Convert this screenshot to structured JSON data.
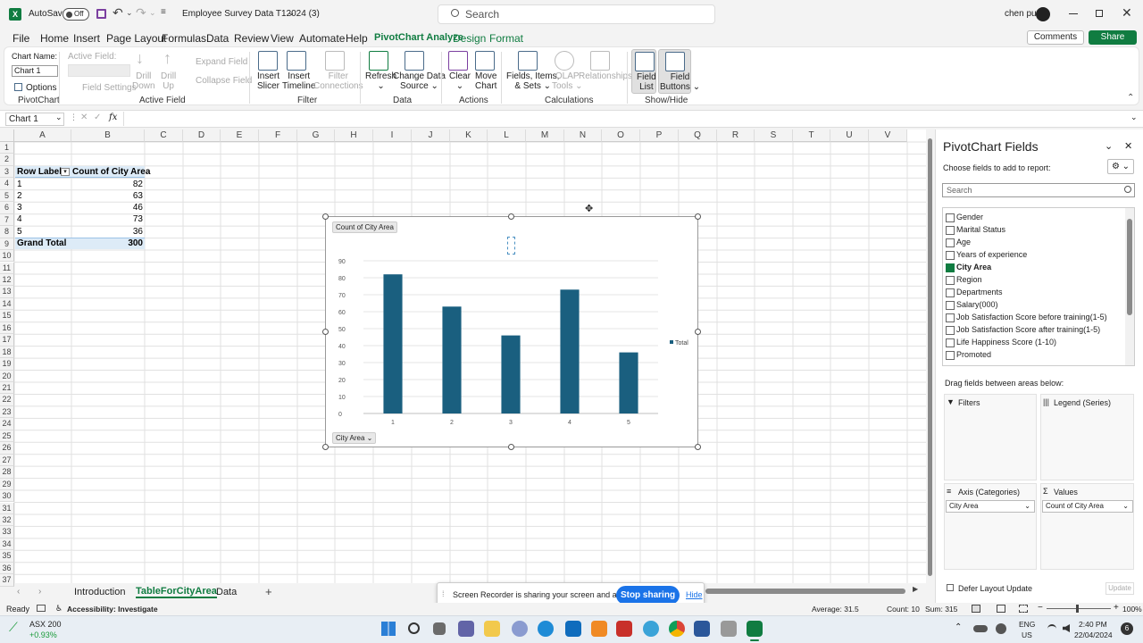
{
  "titlebar": {
    "autosave": "AutoSave",
    "autosave_state": "Off",
    "doc_title": "Employee Survey Data T12024 (3)",
    "search_placeholder": "Search",
    "user": "chen pu"
  },
  "menu": {
    "tabs": [
      "File",
      "Home",
      "Insert",
      "Page Layout",
      "Formulas",
      "Data",
      "Review",
      "View",
      "Automate",
      "Help",
      "PivotChart Analyze",
      "Design",
      "Format"
    ],
    "active": "PivotChart Analyze",
    "comments": "Comments",
    "share": "Share"
  },
  "ribbon": {
    "chart_name_label": "Chart Name:",
    "chart_name_value": "Chart 1",
    "options": "Options",
    "pivotchart_group": "PivotChart",
    "active_field_label": "Active Field:",
    "field_settings": "Field Settings",
    "drill_down": [
      "Drill",
      "Down"
    ],
    "drill_up": [
      "Drill",
      "Up"
    ],
    "expand_field": "Expand Field",
    "collapse_field": "Collapse Field",
    "active_field_group": "Active Field",
    "insert_slicer": [
      "Insert",
      "Slicer"
    ],
    "insert_timeline": [
      "Insert",
      "Timeline"
    ],
    "filter_connections": [
      "Filter",
      "Connections"
    ],
    "filter_group": "Filter",
    "refresh": [
      "Refresh",
      "⌄"
    ],
    "change_data_source": [
      "Change Data",
      "Source ⌄"
    ],
    "data_group": "Data",
    "clear": [
      "Clear",
      "⌄"
    ],
    "move_chart": [
      "Move",
      "Chart"
    ],
    "actions_group": "Actions",
    "fields_items_sets": [
      "Fields, Items,",
      "& Sets ⌄"
    ],
    "olap_tools": [
      "OLAP",
      "Tools ⌄"
    ],
    "relationships": "Relationships",
    "calculations_group": "Calculations",
    "field_list": [
      "Field",
      "List"
    ],
    "field_buttons": [
      "Field",
      "Buttons ⌄"
    ],
    "showhide_group": "Show/Hide"
  },
  "formula_bar": {
    "name_box": "Chart 1",
    "fx": "fx"
  },
  "grid": {
    "columns": [
      "A",
      "B",
      "C",
      "D",
      "E",
      "F",
      "G",
      "H",
      "I",
      "J",
      "K",
      "L",
      "M",
      "N",
      "O",
      "P",
      "Q",
      "R",
      "S",
      "T",
      "U",
      "V"
    ],
    "rows": [
      "1",
      "2",
      "3",
      "4",
      "5",
      "6",
      "7",
      "8",
      "9",
      "10",
      "11",
      "12",
      "13",
      "14",
      "15",
      "16",
      "17",
      "18",
      "19",
      "20",
      "21",
      "22",
      "23",
      "24",
      "25",
      "26",
      "27",
      "28",
      "29",
      "30",
      "31",
      "32",
      "33",
      "34",
      "35",
      "36",
      "37"
    ],
    "pivot_header": [
      "Row Labels",
      "Count of City Area"
    ],
    "pivot_rows": [
      [
        "1",
        "82"
      ],
      [
        "2",
        "63"
      ],
      [
        "3",
        "46"
      ],
      [
        "4",
        "73"
      ],
      [
        "5",
        "36"
      ]
    ],
    "grand_total": [
      "Grand Total",
      "300"
    ]
  },
  "chart_data": {
    "type": "bar",
    "categories": [
      "1",
      "2",
      "3",
      "4",
      "5"
    ],
    "series": [
      {
        "name": "Total",
        "values": [
          82,
          63,
          46,
          73,
          36
        ],
        "color": "#1a5f7f"
      }
    ],
    "title": "",
    "xlabel": "",
    "ylabel": "",
    "ylim": [
      0,
      90
    ],
    "yticks": [
      "0",
      "10",
      "20",
      "30",
      "40",
      "50",
      "60",
      "70",
      "80",
      "90"
    ],
    "grid": true,
    "legend": "right",
    "value_button": "Count of City Area",
    "axis_button": "City Area ⌄"
  },
  "pane": {
    "title": "PivotChart Fields",
    "subtitle": "Choose fields to add to report:",
    "search_placeholder": "Search",
    "fields": [
      {
        "label": "Gender",
        "checked": false
      },
      {
        "label": "Marital Status",
        "checked": false
      },
      {
        "label": "Age",
        "checked": false
      },
      {
        "label": "Years of experience",
        "checked": false
      },
      {
        "label": "City Area",
        "checked": true
      },
      {
        "label": "Region",
        "checked": false
      },
      {
        "label": "Departments",
        "checked": false
      },
      {
        "label": "Salary(000)",
        "checked": false
      },
      {
        "label": "Job Satisfaction Score before training(1-5)",
        "checked": false
      },
      {
        "label": "Job Satisfaction Score after training(1-5)",
        "checked": false
      },
      {
        "label": "Life Happiness Score (1-10)",
        "checked": false
      },
      {
        "label": "Promoted",
        "checked": false
      }
    ],
    "drag_label": "Drag fields between areas below:",
    "filters": "Filters",
    "legend_series": "Legend (Series)",
    "axis_categories": "Axis (Categories)",
    "values": "Values",
    "axis_value": "City Area",
    "values_value": "Count of City Area",
    "defer": "Defer Layout Update",
    "update": "Update"
  },
  "sheets": {
    "tabs": [
      "Introduction",
      "TableForCityArea",
      "Data"
    ],
    "active": "TableForCityArea",
    "add": "+"
  },
  "share_banner": {
    "text": "Screen Recorder is sharing your screen and audio.",
    "stop": "Stop sharing",
    "hide": "Hide"
  },
  "status": {
    "ready": "Ready",
    "accessibility": "Accessibility: Investigate",
    "average": "Average: 31.5",
    "count": "Count: 10",
    "sum": "Sum: 315",
    "zoom": "100%"
  },
  "taskbar": {
    "stock_name": "ASX 200",
    "stock_change": "+0.93%",
    "lang1": "ENG",
    "lang2": "US",
    "time": "2:40 PM",
    "date": "22/04/2024",
    "notifications": "6"
  }
}
